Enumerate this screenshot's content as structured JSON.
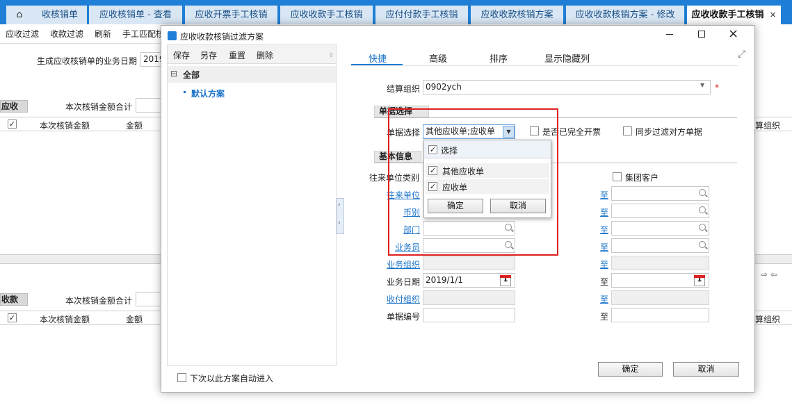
{
  "tabs": [
    "收核销单",
    "应收核销单 - 查看",
    "应收开票手工核销",
    "应收收款手工核销",
    "应付付款手工核销",
    "应收收款核销方案",
    "应收收款核销方案 - 修改",
    "应收收款手工核销"
  ],
  "tab_close": "×",
  "toolbar": {
    "filter": "应收过滤",
    "pay_filter": "收款过滤",
    "refresh": "刷新",
    "manual_match": "手工匹配核"
  },
  "bg": {
    "gen_date_label": "生成应收核销单的业务日期",
    "gen_date_value": "2019",
    "section_ar": "应收",
    "section_rec": "收款",
    "sum_label": "本次核销金额合计",
    "col_amount_this": "本次核销金额",
    "col_amount": "金额",
    "col_settle_org": "算组织",
    "nav_arrows": "⇨ ⇦"
  },
  "dialog": {
    "title": "应收收款核销过滤方案",
    "left_toolbar": {
      "save": "保存",
      "save_as": "另存",
      "reset": "重置",
      "delete": "删除"
    },
    "tree_root": "全部",
    "tree_collapse": "⊟",
    "tree_item": "默认方案",
    "auto_enter": "下次以此方案自动进入",
    "tabs": {
      "quick": "快捷",
      "advanced": "高级",
      "sort": "排序",
      "show_hidden": "显示隐藏列"
    },
    "settle_org_label": "结算组织",
    "settle_org_value": "0902ych",
    "required_mark": "*",
    "section_bill": "单据选择",
    "bill_select_label": "单据选择",
    "bill_select_value": "其他应收单;应收单",
    "fully_invoiced": "是否已完全开票",
    "sync_filter": "同步过滤对方单据",
    "section_basic": "基本信息",
    "partner_type_label": "往来单位类别",
    "group_customer": "集团客户",
    "partner_label": "往来单位",
    "currency_label": "币别",
    "dept_label": "部门",
    "salesman_label": "业务员",
    "biz_org_label": "业务组织",
    "biz_date_label": "业务日期",
    "biz_date_value": "2019/1/1",
    "pay_org_label": "收付组织",
    "bill_no_label": "单据编号",
    "to_label": "至",
    "ok": "确定",
    "cancel": "取消",
    "dropdown": {
      "select_all": "选择",
      "opt1": "其他应收单",
      "opt2": "应收单",
      "ok": "确定",
      "cancel": "取消"
    }
  }
}
